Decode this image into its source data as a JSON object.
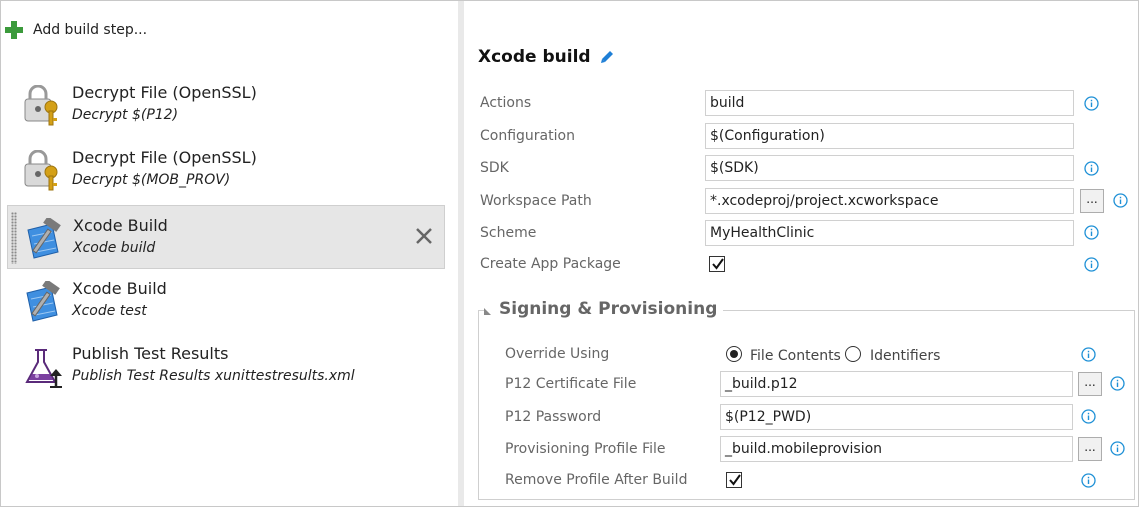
{
  "toolbar": {
    "add_label": "Add build step..."
  },
  "steps": [
    {
      "title": "Decrypt File (OpenSSL)",
      "subtitle": "Decrypt $(P12)",
      "icon": "key-lock-icon"
    },
    {
      "title": "Decrypt File (OpenSSL)",
      "subtitle": "Decrypt $(MOB_PROV)",
      "icon": "key-lock-icon"
    },
    {
      "title": "Xcode Build",
      "subtitle": "Xcode build",
      "icon": "xcode-hammer-icon",
      "selected": true
    },
    {
      "title": "Xcode Build",
      "subtitle": "Xcode test",
      "icon": "xcode-hammer-icon"
    },
    {
      "title": "Publish Test Results",
      "subtitle": "Publish Test Results xunittestresults.xml",
      "icon": "flask-upload-icon"
    }
  ],
  "task": {
    "title": "Xcode build",
    "fields": {
      "actions": {
        "label": "Actions",
        "value": "build"
      },
      "configuration": {
        "label": "Configuration",
        "value": "$(Configuration)"
      },
      "sdk": {
        "label": "SDK",
        "value": "$(SDK)"
      },
      "workspace": {
        "label": "Workspace Path",
        "value": "*.xcodeproj/project.xcworkspace",
        "browse": "..."
      },
      "scheme": {
        "label": "Scheme",
        "value": "MyHealthClinic"
      },
      "create_app_package": {
        "label": "Create App Package",
        "checked": true
      }
    }
  },
  "signing": {
    "title": "Signing & Provisioning",
    "override": {
      "label": "Override Using",
      "options": [
        "File Contents",
        "Identifiers"
      ],
      "selected": "File Contents"
    },
    "p12_file": {
      "label": "P12 Certificate File",
      "value": "_build.p12",
      "browse": "..."
    },
    "p12_password": {
      "label": "P12 Password",
      "value": "$(P12_PWD)"
    },
    "profile_file": {
      "label": "Provisioning Profile File",
      "value": "_build.mobileprovision",
      "browse": "..."
    },
    "remove_profile": {
      "label": "Remove Profile After Build",
      "checked": true
    }
  },
  "colors": {
    "accent": "#1e7fd6",
    "info": "#1e90d6",
    "add_green": "#3b9a3b",
    "selected_bg": "#e6e6e6",
    "label_gray": "#666666"
  }
}
